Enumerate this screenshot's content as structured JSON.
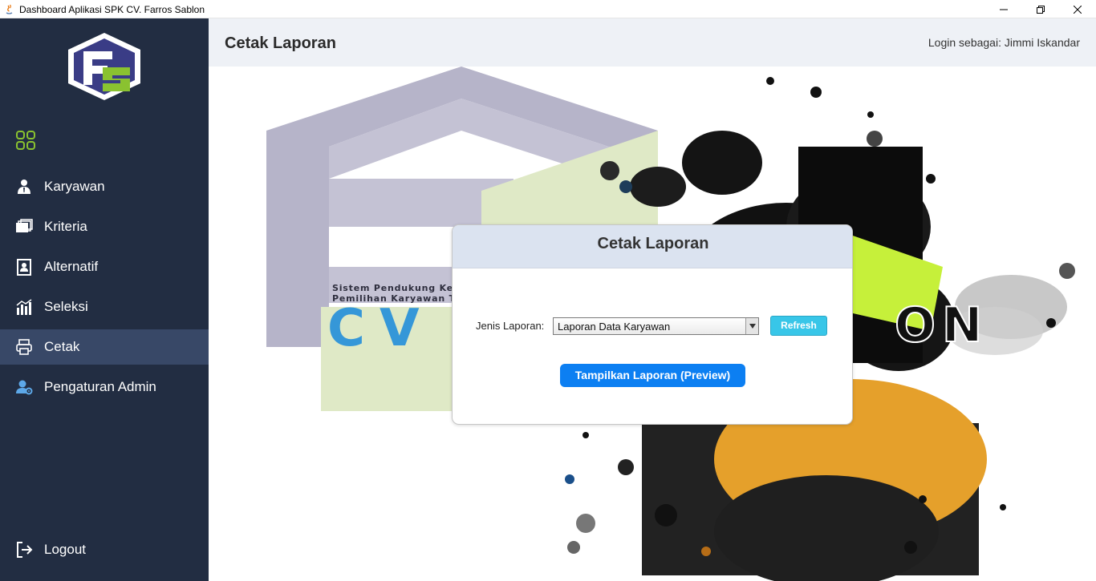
{
  "window": {
    "title": "Dashboard Aplikasi SPK CV. Farros Sablon",
    "minimize_icon": "minimize-icon",
    "maximize_icon": "restore-icon",
    "close_icon": "close-icon"
  },
  "sidebar": {
    "logo_icon": "fs-logo",
    "dashboard_icon": "dashboard-grid-icon",
    "items": [
      {
        "label": "Karyawan",
        "icon": "person-icon",
        "active": false
      },
      {
        "label": "Kriteria",
        "icon": "folders-icon",
        "active": false
      },
      {
        "label": "Alternatif",
        "icon": "id-card-icon",
        "active": false
      },
      {
        "label": "Seleksi",
        "icon": "bar-chart-icon",
        "active": false
      },
      {
        "label": "Cetak",
        "icon": "printer-icon",
        "active": true
      },
      {
        "label": "Pengaturan Admin",
        "icon": "user-settings-icon",
        "active": false
      }
    ],
    "logout": {
      "label": "Logout",
      "icon": "logout-icon"
    }
  },
  "header": {
    "title": "Cetak Laporan",
    "login_text": "Login sebagai: Jimmi Iskandar"
  },
  "background": {
    "subtitle_line1": "Sistem Pendukung Kepu",
    "subtitle_line2": "Pemilihan Karyawan Te",
    "brand_text": "CV F",
    "banner_text": "ON"
  },
  "dialog": {
    "title": "Cetak Laporan",
    "field_label": "Jenis Laporan:",
    "select_value": "Laporan Data Karyawan",
    "refresh_label": "Refresh",
    "preview_label": "Tampilkan Laporan (Preview)"
  },
  "colors": {
    "sidebar_bg": "#222d42",
    "sidebar_active": "#384867",
    "accent_green": "#8ac230",
    "header_bg": "#eef1f6",
    "primary_button": "#0c7ff2",
    "refresh_button": "#38c6e8"
  }
}
